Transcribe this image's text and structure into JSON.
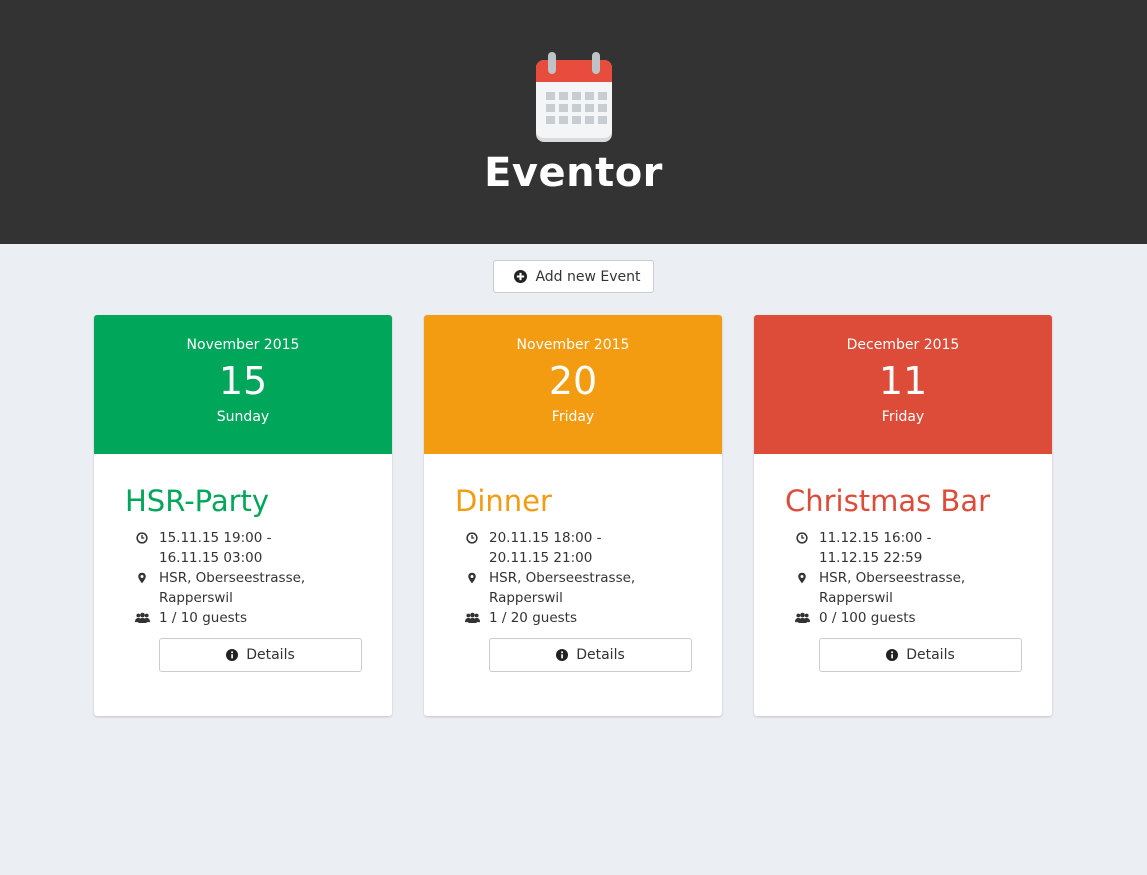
{
  "app": {
    "title": "Eventor"
  },
  "toolbar": {
    "add_label": "Add new Event"
  },
  "events": [
    {
      "month": "November 2015",
      "day": "15",
      "weekday": "Sunday",
      "title": "HSR-Party",
      "color": "#00a65a",
      "time_start": "15.11.15 19:00 -",
      "time_end": "16.11.15 03:00",
      "location_line1": "HSR, Oberseestrasse,",
      "location_line2": "Rapperswil",
      "guests": "1 / 10 guests",
      "details_label": "Details"
    },
    {
      "month": "November 2015",
      "day": "20",
      "weekday": "Friday",
      "title": "Dinner",
      "color": "#f39c12",
      "time_start": "20.11.15 18:00 -",
      "time_end": "20.11.15 21:00",
      "location_line1": "HSR, Oberseestrasse,",
      "location_line2": "Rapperswil",
      "guests": "1 / 20 guests",
      "details_label": "Details"
    },
    {
      "month": "December 2015",
      "day": "11",
      "weekday": "Friday",
      "title": "Christmas Bar",
      "color": "#dd4b39",
      "time_start": "11.12.15 16:00 -",
      "time_end": "11.12.15 22:59",
      "location_line1": "HSR, Oberseestrasse,",
      "location_line2": "Rapperswil",
      "guests": "0 / 100 guests",
      "details_label": "Details"
    }
  ],
  "icons": {
    "logo": "calendar-icon",
    "add": "plus-circle-icon",
    "time": "clock-icon",
    "location": "map-marker-icon",
    "guests": "users-icon",
    "details": "info-circle-icon"
  }
}
